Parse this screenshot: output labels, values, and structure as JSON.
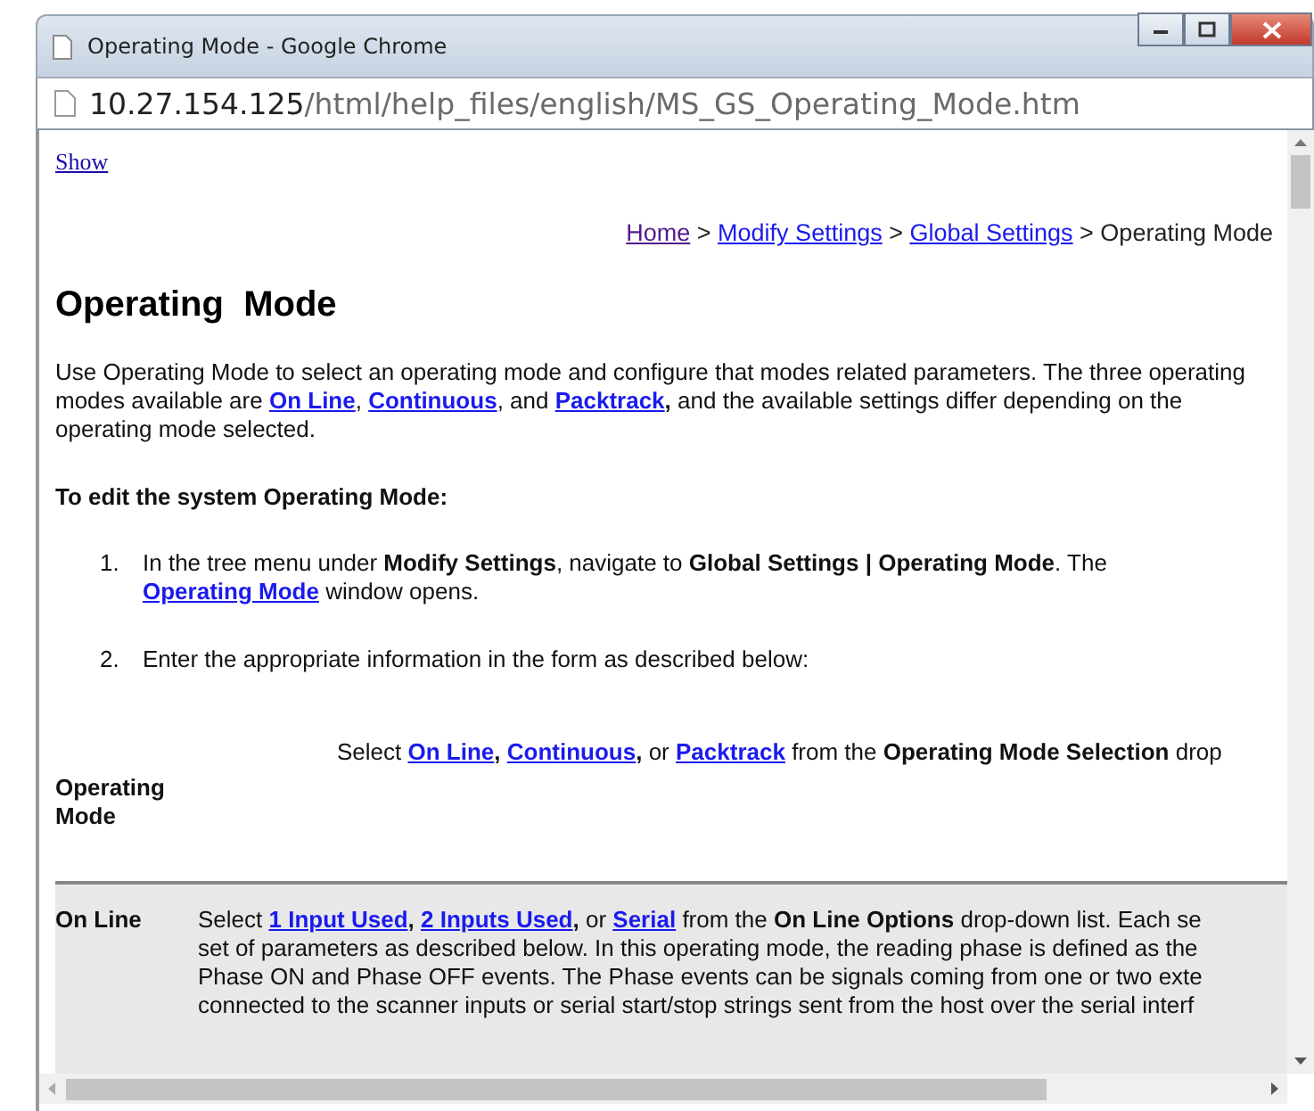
{
  "window": {
    "title": "Operating Mode - Google Chrome"
  },
  "address_bar": {
    "host": "10.27.154.125",
    "path": "/html/help_files/english/MS_GS_Operating_Mode.htm"
  },
  "show_link": "Show",
  "breadcrumb": [
    {
      "text": "Home",
      "kind": "visited"
    },
    {
      "text": " > ",
      "kind": "text"
    },
    {
      "text": "Modify Settings",
      "kind": "link"
    },
    {
      "text": " > ",
      "kind": "text"
    },
    {
      "text": "Global Settings",
      "kind": "link"
    },
    {
      "text": " > Operating Mode",
      "kind": "text"
    }
  ],
  "heading": "Operating  Mode",
  "intro": [
    {
      "text": "Use Operating Mode to select an operating mode and configure that modes related parameters. The three operating modes available are ",
      "kind": "text"
    },
    {
      "text": "On Line",
      "kind": "boldlink"
    },
    {
      "text": ", ",
      "kind": "text"
    },
    {
      "text": "Continuous",
      "kind": "boldlink"
    },
    {
      "text": ", and ",
      "kind": "text"
    },
    {
      "text": "Packtrack",
      "kind": "boldlink"
    },
    {
      "text": ",",
      "kind": "bold"
    },
    {
      "text": " and the available settings differ depending on the operating mode selected.",
      "kind": "text"
    }
  ],
  "procedure_title": "To edit the system Operating Mode:",
  "steps": [
    {
      "number": "1.",
      "segments": [
        {
          "text": "In the tree menu under ",
          "kind": "text"
        },
        {
          "text": "Modify Settings",
          "kind": "bold"
        },
        {
          "text": ", navigate to ",
          "kind": "text"
        },
        {
          "text": "Global Settings | Operating Mode",
          "kind": "bold"
        },
        {
          "text": ". The ",
          "kind": "text"
        },
        {
          "text": "Operating Mode",
          "kind": "boldlink"
        },
        {
          "text": " window opens.",
          "kind": "text"
        }
      ]
    },
    {
      "number": "2.",
      "segments": [
        {
          "text": "Enter the appropriate information in the form as described below:",
          "kind": "text"
        }
      ]
    }
  ],
  "table": {
    "rows": [
      {
        "label": "Operating Mode",
        "shaded": false,
        "lines": [
          [
            {
              "text": "Select ",
              "kind": "text"
            },
            {
              "text": "On Line",
              "kind": "boldlink"
            },
            {
              "text": ", ",
              "kind": "bold"
            },
            {
              "text": "Continuous",
              "kind": "boldlink"
            },
            {
              "text": ", ",
              "kind": "bold"
            },
            {
              "text": "or ",
              "kind": "text"
            },
            {
              "text": "Packtrack",
              "kind": "boldlink"
            },
            {
              "text": " from the ",
              "kind": "text"
            },
            {
              "text": "Operating Mode Selection",
              "kind": "bold"
            },
            {
              "text": " drop",
              "kind": "text"
            }
          ]
        ]
      },
      {
        "label": "On Line",
        "shaded": true,
        "lines": [
          [
            {
              "text": "Select ",
              "kind": "text"
            },
            {
              "text": "1 Input Used",
              "kind": "boldlink"
            },
            {
              "text": ", ",
              "kind": "bold"
            },
            {
              "text": "2 Inputs Used",
              "kind": "boldlink"
            },
            {
              "text": ", ",
              "kind": "bold"
            },
            {
              "text": "or ",
              "kind": "text"
            },
            {
              "text": "Serial",
              "kind": "boldlink"
            },
            {
              "text": " from the ",
              "kind": "text"
            },
            {
              "text": "On Line Options",
              "kind": "bold"
            },
            {
              "text": " drop-down list. Each se",
              "kind": "text"
            }
          ],
          [
            {
              "text": "set of parameters as described below. In this operating mode, the reading phase is defined as the",
              "kind": "text"
            }
          ],
          [
            {
              "text": "Phase ON and Phase OFF events. The Phase events can be signals coming from one or two exte",
              "kind": "text"
            }
          ],
          [
            {
              "text": "connected to the scanner inputs or serial start/stop strings sent from the host over the serial interf",
              "kind": "text"
            }
          ]
        ]
      }
    ]
  }
}
